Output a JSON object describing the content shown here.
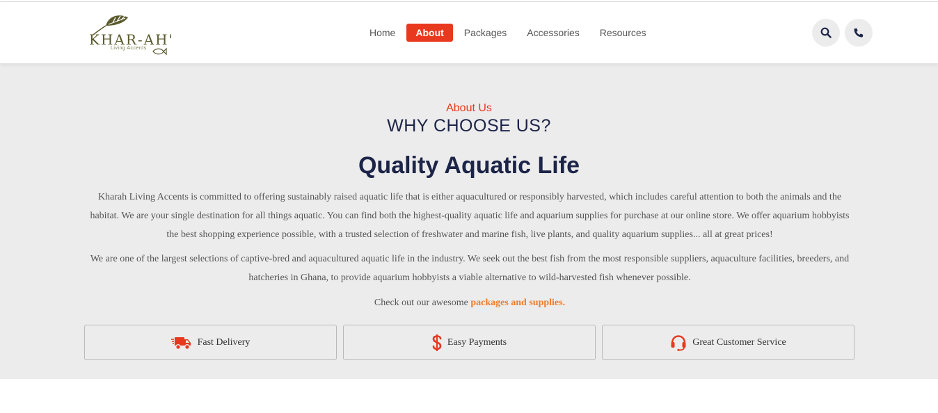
{
  "brand": {
    "name": "KHAR-AH'",
    "tagline": "Living Accents",
    "leaf_color": "#5a5a2e"
  },
  "nav": {
    "items": [
      {
        "label": "Home",
        "active": false
      },
      {
        "label": "About",
        "active": true
      },
      {
        "label": "Packages",
        "active": false
      },
      {
        "label": "Accessories",
        "active": false
      },
      {
        "label": "Resources",
        "active": false
      }
    ],
    "active_color": "#e8381e"
  },
  "header_actions": {
    "search_icon": "search-icon",
    "phone_icon": "phone-icon"
  },
  "about": {
    "eyebrow": "About Us",
    "heading": "WHY CHOOSE US?",
    "subheading": "Quality Aquatic Life",
    "paragraph1": "Kharah Living Accents is committed to offering sustainably raised aquatic life that is either aquacultured or responsibly harvested, which includes careful attention to both the animals and the habitat. We are your single destination for all things aquatic. You can find both the highest-quality aquatic life and aquarium supplies for purchase at our online store. We offer aquarium hobbyists the best shopping experience possible, with a trusted selection of freshwater and marine fish, live plants, and quality aquarium supplies... all at great prices!",
    "paragraph2": "We are one of the largest selections of captive-bred and aquacultured aquatic life in the industry. We seek out the best fish from the most responsible suppliers, aquaculture facilities, breeders, and hatcheries in Ghana, to provide aquarium hobbyists a viable alternative to wild-harvested fish whenever possible.",
    "cta_prefix": "Check out our awesome",
    "cta_link": "packages and supplies."
  },
  "features": [
    {
      "label": "Fast Delivery",
      "icon": "truck-icon"
    },
    {
      "label": "Easy Payments",
      "icon": "dollar-icon"
    },
    {
      "label": "Great Customer Service",
      "icon": "headset-icon"
    }
  ],
  "colors": {
    "accent": "#e8381e",
    "link": "#f07c2a",
    "heading": "#1c2447",
    "section_bg": "#ececec"
  }
}
